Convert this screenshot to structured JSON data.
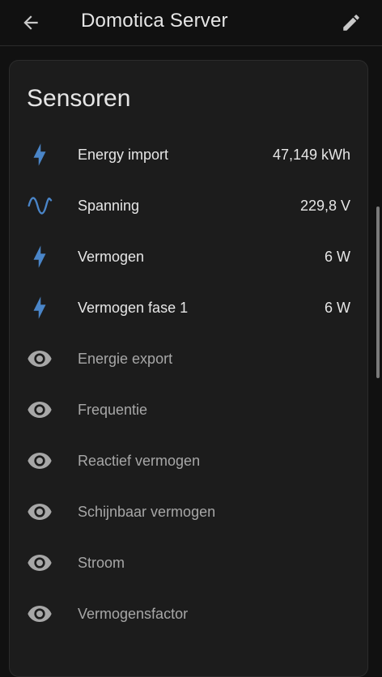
{
  "app_bar": {
    "title": "Domotica Server",
    "back_icon": "arrow-left-icon",
    "edit_icon": "pencil-icon"
  },
  "colors": {
    "background": "#111111",
    "card": "#1c1c1c",
    "accent_icon": "#4a85c8",
    "inactive_icon": "#a7a7a7"
  },
  "card": {
    "title": "Sensoren",
    "sensors": [
      {
        "icon": "lightning-bolt-icon",
        "name": "Energy import",
        "value": "47,149 kWh",
        "active": true
      },
      {
        "icon": "sine-wave-icon",
        "name": "Spanning",
        "value": "229,8 V",
        "active": true
      },
      {
        "icon": "lightning-bolt-icon",
        "name": "Vermogen",
        "value": "6 W",
        "active": true
      },
      {
        "icon": "lightning-bolt-icon",
        "name": "Vermogen fase 1",
        "value": "6 W",
        "active": true
      },
      {
        "icon": "eye-icon",
        "name": "Energie export",
        "value": "",
        "active": false
      },
      {
        "icon": "eye-icon",
        "name": "Frequentie",
        "value": "",
        "active": false
      },
      {
        "icon": "eye-icon",
        "name": "Reactief vermogen",
        "value": "",
        "active": false
      },
      {
        "icon": "eye-icon",
        "name": "Schijnbaar vermogen",
        "value": "",
        "active": false
      },
      {
        "icon": "eye-icon",
        "name": "Stroom",
        "value": "",
        "active": false
      },
      {
        "icon": "eye-icon",
        "name": "Vermogensfactor",
        "value": "",
        "active": false
      }
    ]
  }
}
